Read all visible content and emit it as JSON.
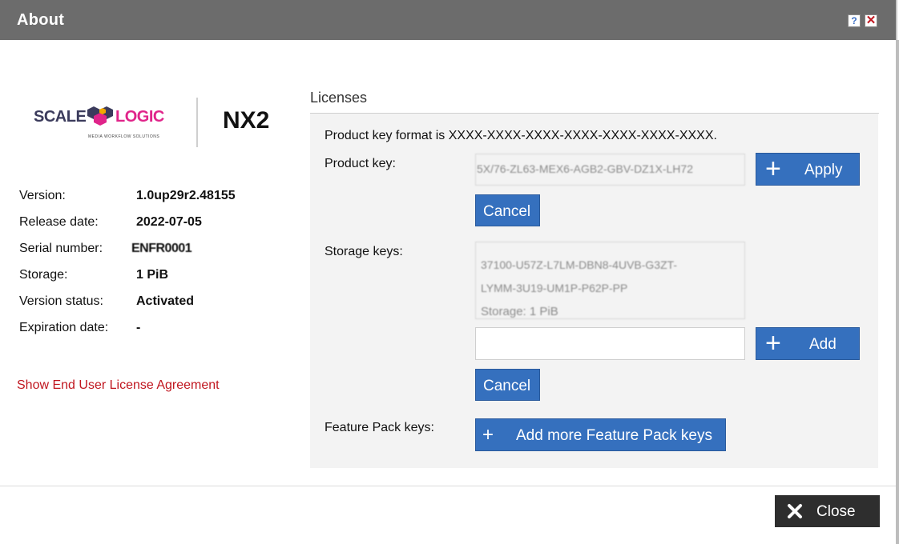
{
  "window": {
    "title": "About",
    "help_label": "?",
    "close_label": "✕"
  },
  "logo": {
    "brand_left": "SCALE",
    "brand_right": "LOGIC",
    "tagline": "MEDIA WORKFLOW SOLUTIONS",
    "product": "NX2"
  },
  "info": [
    {
      "label": "Version:",
      "value": "1.0up29r2.48155"
    },
    {
      "label": "Release date:",
      "value": "2022-07-05"
    },
    {
      "label": "Serial number:",
      "value": "ENFR0001"
    },
    {
      "label": "Storage:",
      "value": "1 PiB"
    },
    {
      "label": "Version status:",
      "value": "Activated"
    },
    {
      "label": "Expiration date:",
      "value": "-"
    }
  ],
  "eula_link": "Show End User License Agreement",
  "licenses": {
    "title": "Licenses",
    "format_text": "Product key format is XXXX-XXXX-XXXX-XXXX-XXXX-XXXX-XXXX.",
    "product_key": {
      "label": "Product key:",
      "value": "5X/76-ZL63-MEX6-AGB2-GBV-DZ1X-LH72",
      "apply_label": "Apply",
      "cancel_label": "Cancel"
    },
    "storage_keys": {
      "label": "Storage keys:",
      "lines": [
        "37100-U57Z-L7LM-DBN8-4UVB-G3ZT-",
        "LYMM-3U19-UM1P-P62P-PP",
        "Storage: 1 PiB"
      ],
      "input_value": "",
      "add_label": "Add",
      "cancel_label": "Cancel"
    },
    "feature_pack": {
      "label": "Feature Pack keys:",
      "add_more_label": "Add more Feature Pack keys"
    }
  },
  "footer": {
    "close_label": "Close"
  },
  "colors": {
    "titlebar": "#6c6c6c",
    "primary_button": "#3570be",
    "link": "#c0161f",
    "close_button": "#2e2e2e"
  },
  "icons": {
    "apply": "plus-icon",
    "add": "plus-icon",
    "feature": "plus-icon",
    "close": "x-icon"
  }
}
